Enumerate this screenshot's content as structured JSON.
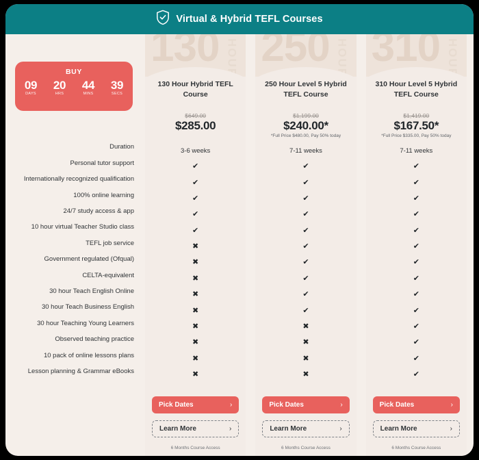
{
  "header": {
    "title": "Virtual & Hybrid TEFL Courses",
    "icon": "shield-check-icon",
    "background_color": "#0c7f85"
  },
  "countdown": {
    "title": "BUY",
    "background_color": "#e8615d",
    "units": [
      {
        "value": "09",
        "name": "DAYS"
      },
      {
        "value": "20",
        "name": "HRS"
      },
      {
        "value": "44",
        "name": "MINS"
      },
      {
        "value": "39",
        "name": "SECS"
      }
    ]
  },
  "features": [
    "Duration",
    "Personal tutor support",
    "Internationally recognized qualification",
    "100% online learning",
    "24/7 study access & app",
    "10 hour virtual Teacher Studio class",
    "TEFL job service",
    "Government regulated (Ofqual)",
    "CELTA-equivalent",
    "30 hour Teach English Online",
    "30 hour Teach Business English",
    "30 hour Teaching Young Learners",
    "Observed teaching practice",
    "10 pack of online lessons plans",
    "Lesson planning & Grammar eBooks"
  ],
  "buttons": {
    "primary_label": "Pick Dates",
    "secondary_label": "Learn More",
    "chevron": "›",
    "primary_color": "#e8615d"
  },
  "marks": {
    "check": "✔",
    "cross": "✖"
  },
  "columns": [
    {
      "watermark_number": "130",
      "watermark_unit": "HOUR",
      "title": "130 Hour Hybrid TEFL Course",
      "price_old": "$649.00",
      "price_now": "$285.00",
      "price_note": "",
      "duration": "3-6 weeks",
      "values": [
        "yes",
        "yes",
        "yes",
        "yes",
        "yes",
        "no",
        "no",
        "no",
        "no",
        "no",
        "no",
        "no",
        "no",
        "no"
      ],
      "access_note": "6 Months Course Access"
    },
    {
      "watermark_number": "250",
      "watermark_unit": "HOUR",
      "title": "250 Hour Level 5 Hybrid TEFL Course",
      "price_old": "$1,199.00",
      "price_now": "$240.00*",
      "price_note": "*Full Price $480.00, Pay 50% today",
      "duration": "7-11 weeks",
      "values": [
        "yes",
        "yes",
        "yes",
        "yes",
        "yes",
        "yes",
        "yes",
        "yes",
        "yes",
        "yes",
        "no",
        "no",
        "no",
        "no"
      ],
      "access_note": "6 Months Course Access"
    },
    {
      "watermark_number": "310",
      "watermark_unit": "HOUR",
      "title": "310 Hour Level 5 Hybrid TEFL Course",
      "price_old": "$1,419.00",
      "price_now": "$167.50*",
      "price_note": "*Full Price $335.00, Pay 50% today",
      "duration": "7-11 weeks",
      "values": [
        "yes",
        "yes",
        "yes",
        "yes",
        "yes",
        "yes",
        "yes",
        "yes",
        "yes",
        "yes",
        "yes",
        "yes",
        "yes",
        "yes"
      ],
      "access_note": "6 Months Course Access"
    }
  ]
}
